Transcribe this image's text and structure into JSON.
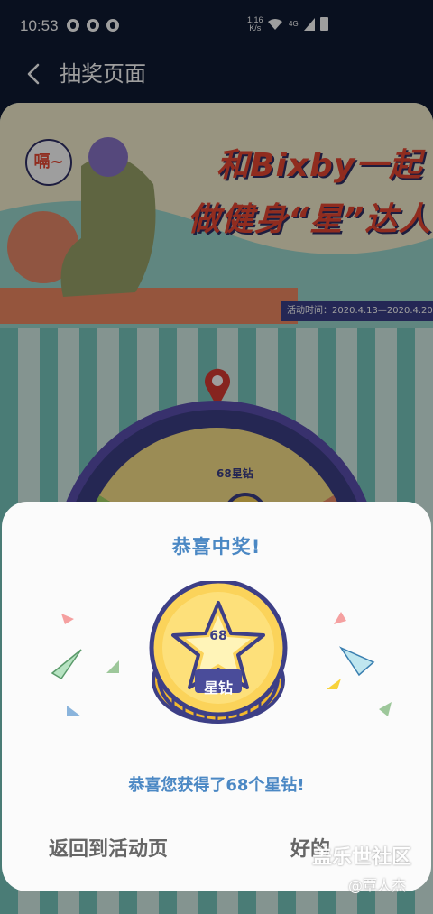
{
  "status_bar": {
    "time": "10:53",
    "net_speed_value": "1.16",
    "net_speed_unit": "K/s",
    "network_type": "4G"
  },
  "header": {
    "title": "抽奖页面"
  },
  "banner": {
    "title_line1": "和Bixby一起",
    "title_line2": "做健身“星”达人",
    "speech": "嗝~",
    "activity_time": "活动时间：2020.4.13—2020.4.20"
  },
  "wheel": {
    "prize_label": "68星钻"
  },
  "dialog": {
    "title": "恭喜中奖!",
    "coin_count": "68",
    "coin_label": "星钻",
    "message": "恭喜您获得了68个星钻!",
    "return_button": "返回到活动页",
    "ok_button": "好的"
  },
  "watermark": {
    "site": "盖乐世社区",
    "user": "@覃人杰"
  },
  "colors": {
    "dialog_accent": "#4b88c4",
    "coin_gold": "#fbd35a",
    "coin_outline": "#3d3f86",
    "status_bg": "#0f1a33"
  }
}
